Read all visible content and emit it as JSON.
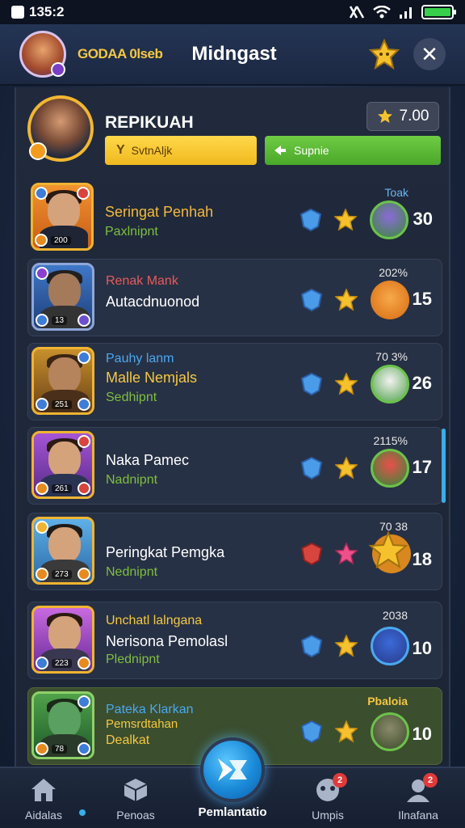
{
  "status_bar": {
    "time": "135:2"
  },
  "header": {
    "currency_label": "GODAA 0lseb",
    "title": "Midngast",
    "close_symbol": "✕"
  },
  "me": {
    "name": "REPIKUAH",
    "score": "7.00",
    "primary_button": "SvtnAljk",
    "secondary_button": "Supnie"
  },
  "rows": [
    {
      "header": "",
      "name": "Seringat Penhah",
      "sub": "Paxlnipnt",
      "percent": "Toak",
      "rank": "30",
      "thumb_num": "200",
      "name_color": "#f5b93c"
    },
    {
      "header": "Renak Mank",
      "name": "Autacdnuonod",
      "sub": "",
      "percent": "202%",
      "rank": "15",
      "thumb_num": "13",
      "name_color": "#ffffff"
    },
    {
      "header": "Pauhy lanm",
      "name": "Malle Nemjals",
      "sub": "Sedhipnt",
      "percent": "70 3%",
      "rank": "26",
      "thumb_num": "251",
      "name_color": "#f5c842"
    },
    {
      "header": "",
      "name": "Naka Pamec",
      "sub": "Nadnipnt",
      "percent": "2115%",
      "rank": "17",
      "thumb_num": "261",
      "name_color": "#ffffff"
    },
    {
      "header": "",
      "name": "Peringkat Pemgka",
      "sub": "Nednipnt",
      "percent": "70 38",
      "rank": "18",
      "thumb_num": "273",
      "name_color": "#ffffff"
    },
    {
      "header": "Unchatl lalngana",
      "name": "Nerisona Pemolasl",
      "sub": "Plednipnt",
      "percent": "2038",
      "rank": "10",
      "thumb_num": "223",
      "name_color": "#ffffff"
    },
    {
      "header": "Pateka Klarkan",
      "name": "Pemsrdtahan",
      "sub": "Dealkat",
      "percent": "Pbaloia",
      "rank": "10",
      "thumb_num": "78",
      "name_color": "#f5c842"
    }
  ],
  "nav": {
    "items": [
      {
        "label": "Aidalas",
        "icon": "home-icon"
      },
      {
        "label": "Penoas",
        "icon": "cube-icon"
      },
      {
        "label": "Pemlantatio",
        "icon": "battle-icon"
      },
      {
        "label": "Umpis",
        "icon": "chat-icon",
        "badge": "2"
      },
      {
        "label": "Ilnafana",
        "icon": "profile-icon",
        "badge": "2"
      }
    ]
  }
}
